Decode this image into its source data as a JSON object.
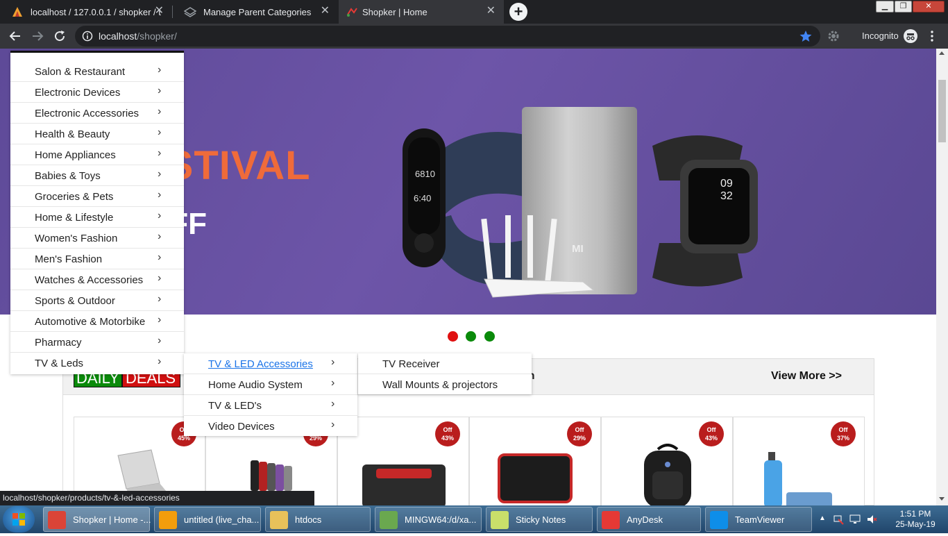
{
  "browser": {
    "tabs": [
      {
        "title": "localhost / 127.0.0.1 / shopker / t"
      },
      {
        "title": "Manage Parent Categories"
      },
      {
        "title": "Shopker | Home"
      }
    ],
    "close_glyph": "✕",
    "new_tab_glyph": "+",
    "window_buttons": [
      "▁",
      "❐",
      "✕"
    ],
    "address_host": "localhost",
    "address_path": "/shopker/",
    "incognito_label": "Incognito",
    "status_url": "localhost/shopker/products/tv-&-led-accessories"
  },
  "banner": {
    "headline_fragment": "ESTIVAL",
    "subline_fragment": "OFF",
    "device_texts": [
      "6810",
      "6:40",
      "MI",
      "09",
      "32"
    ]
  },
  "carousel": {
    "dot_colors": [
      "#e01010",
      "#0a8a0a",
      "#0a8a0a"
    ]
  },
  "deals": {
    "label_part1": "DAILY",
    "label_part2": "DEALS",
    "heading_fragment": "on",
    "view_more": "View More >>",
    "products": [
      {
        "discount": "45%"
      },
      {
        "discount": "29%"
      },
      {
        "discount": "43%"
      },
      {
        "discount": "29%"
      },
      {
        "discount": "43%"
      },
      {
        "discount": "37%"
      }
    ],
    "badge_word": "Off"
  },
  "category_menu": {
    "items": [
      "Salon & Restaurant",
      "Electronic Devices",
      "Electronic Accessories",
      "Health & Beauty",
      "Home Appliances",
      "Babies & Toys",
      "Groceries & Pets",
      "Home & Lifestyle",
      "Women's Fashion",
      "Men's Fashion",
      "Watches & Accessories",
      "Sports & Outdoor",
      "Automotive & Motorbike",
      "Pharmacy",
      "TV & Leds"
    ],
    "chevron": "›"
  },
  "submenu_tv": {
    "items": [
      "TV & LED Accessories",
      "Home Audio System",
      "TV & LED's",
      "Video Devices"
    ]
  },
  "submenu_accessories": {
    "items": [
      "TV Receiver",
      "Wall Mounts & projectors"
    ]
  },
  "taskbar": {
    "items": [
      {
        "label": "Shopker | Home -...",
        "color": "#db4437"
      },
      {
        "label": "untitled (live_cha...",
        "color": "#f29d0c"
      },
      {
        "label": "htdocs",
        "color": "#e8c15a"
      },
      {
        "label": "MINGW64:/d/xa...",
        "color": "#6aa84f"
      },
      {
        "label": "Sticky Notes",
        "color": "#c9df6a"
      },
      {
        "label": "AnyDesk",
        "color": "#e53935"
      },
      {
        "label": "TeamViewer",
        "color": "#0e8ee9"
      }
    ],
    "time": "1:51 PM",
    "date": "25-May-19"
  },
  "colors": {
    "accent_link": "#1a73e8",
    "badge": "#b91d1d",
    "banner_purple": "#6d55a8",
    "banner_orange": "#ef6b3a"
  }
}
